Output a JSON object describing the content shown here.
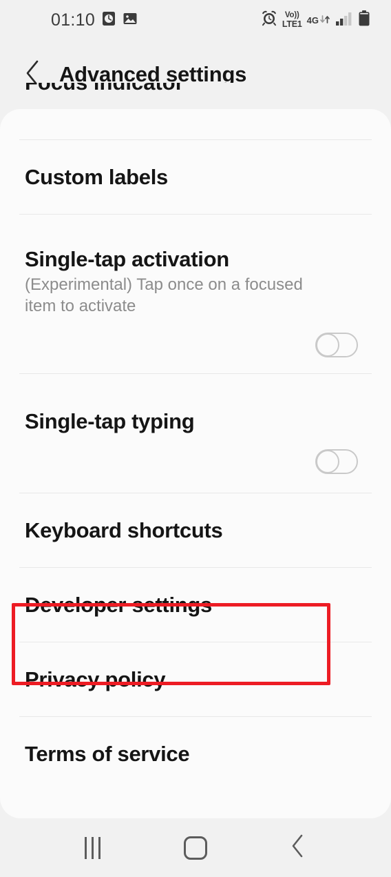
{
  "statusbar": {
    "time": "01:10",
    "left_icons": [
      {
        "name": "alarm-clock-square-icon"
      },
      {
        "name": "gallery-image-icon"
      }
    ],
    "right_icons": [
      {
        "name": "alarm-bell-icon"
      },
      {
        "name": "volte-icon",
        "top": "Vo))",
        "bottom": "LTE1"
      },
      {
        "name": "network-4g-icon",
        "label": "4G"
      },
      {
        "name": "data-transfer-arrows-icon"
      },
      {
        "name": "signal-bars-icon",
        "bars_filled": 2,
        "bars_total": 4
      },
      {
        "name": "battery-icon",
        "level": 90
      }
    ]
  },
  "header": {
    "back_label": "back",
    "title": "Advanced settings"
  },
  "clipped_item": {
    "label": "Focus indicator"
  },
  "list": {
    "items": [
      {
        "id": "custom-labels",
        "label": "Custom labels",
        "type": "simple"
      },
      {
        "id": "single-tap-activation",
        "label": "Single-tap activation",
        "subtitle": "(Experimental) Tap once on a focused item to activate",
        "type": "toggle",
        "toggle_state": "off"
      },
      {
        "id": "single-tap-typing",
        "label": "Single-tap typing",
        "type": "toggle",
        "toggle_state": "off"
      },
      {
        "id": "keyboard-shortcuts",
        "label": "Keyboard shortcuts",
        "type": "simple"
      },
      {
        "id": "developer-settings",
        "label": "Developer settings",
        "type": "simple",
        "highlighted": true
      },
      {
        "id": "privacy-policy",
        "label": "Privacy policy",
        "type": "simple"
      },
      {
        "id": "terms-of-service",
        "label": "Terms of service",
        "type": "simple"
      }
    ]
  },
  "highlight": {
    "target": "Developer settings",
    "color": "#ed1c24"
  },
  "navbar": {
    "recents_label": "Recents",
    "home_label": "Home",
    "back_label": "Back"
  },
  "colors": {
    "background": "#f1f1f1",
    "card": "#fbfbfb",
    "text_primary": "#151515",
    "text_secondary": "#8c8c8c",
    "divider": "#e8e8e8",
    "highlight": "#ed1c24"
  }
}
